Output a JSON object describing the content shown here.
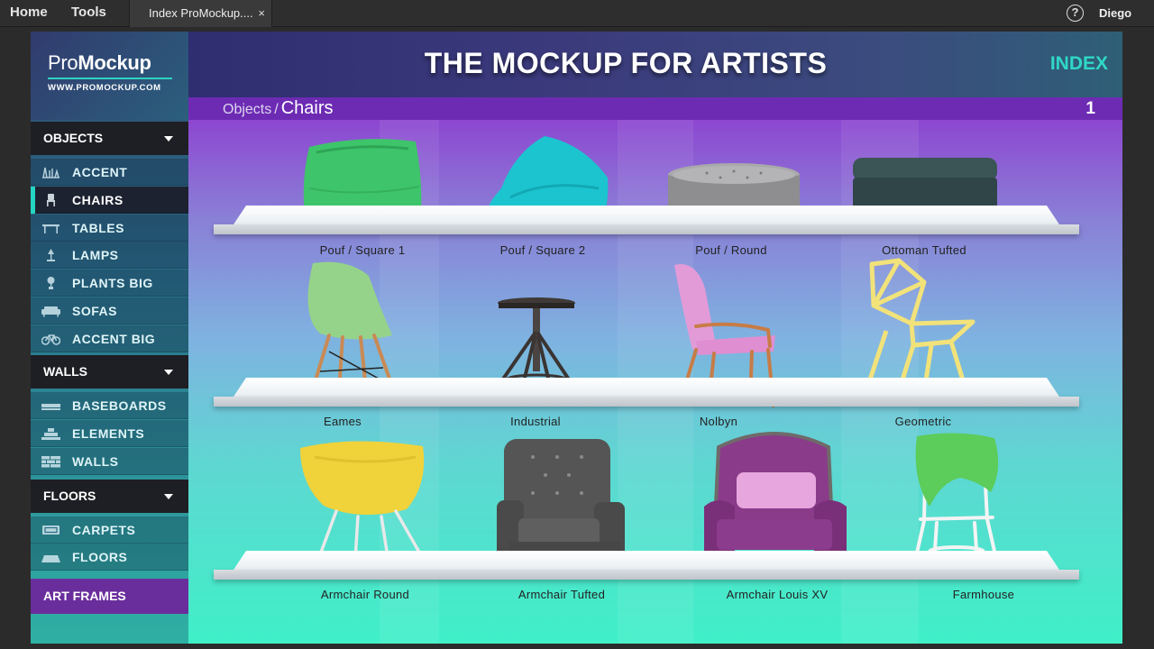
{
  "topbar": {
    "home": "Home",
    "tools": "Tools",
    "tab_title": "Index ProMockup....",
    "tab_close": "×",
    "help": "?",
    "user": "Diego"
  },
  "sidebar": {
    "brand_a": "Pro",
    "brand_b": "Mockup",
    "url": "WWW.PROMOCKUP.COM",
    "sections": [
      {
        "label": "OBJECTS",
        "items": [
          "ACCENT",
          "CHAIRS",
          "TABLES",
          "LAMPS",
          "PLANTS BIG",
          "SOFAS",
          "ACCENT BIG"
        ],
        "active": "CHAIRS"
      },
      {
        "label": "WALLS",
        "items": [
          "BASEBOARDS",
          "ELEMENTS",
          "WALLS"
        ]
      },
      {
        "label": "FLOORS",
        "items": [
          "CARPETS",
          "FLOORS"
        ]
      }
    ],
    "art_frames": "ART FRAMES"
  },
  "header": {
    "title": "THE MOCKUP FOR ARTISTS",
    "index": "INDEX"
  },
  "breadcrumb": {
    "parent": "Objects",
    "separator": "/",
    "current": "Chairs",
    "page": "1"
  },
  "products": [
    [
      "Pouf / Square 1",
      "Pouf / Square 2",
      "Pouf / Round",
      "Ottoman Tufted"
    ],
    [
      "Eames",
      "Industrial",
      "Nolbyn",
      "Geometric"
    ],
    [
      "Armchair Round",
      "Armchair Tufted",
      "Armchair Louis XV",
      "Farmhouse"
    ]
  ],
  "colors": {
    "accent_teal": "#2fd8c6",
    "nav_dark": "#1e1f24",
    "art_frames_purple": "#6a2e9c",
    "breadcrumb_purple": "#6d2bb4"
  }
}
